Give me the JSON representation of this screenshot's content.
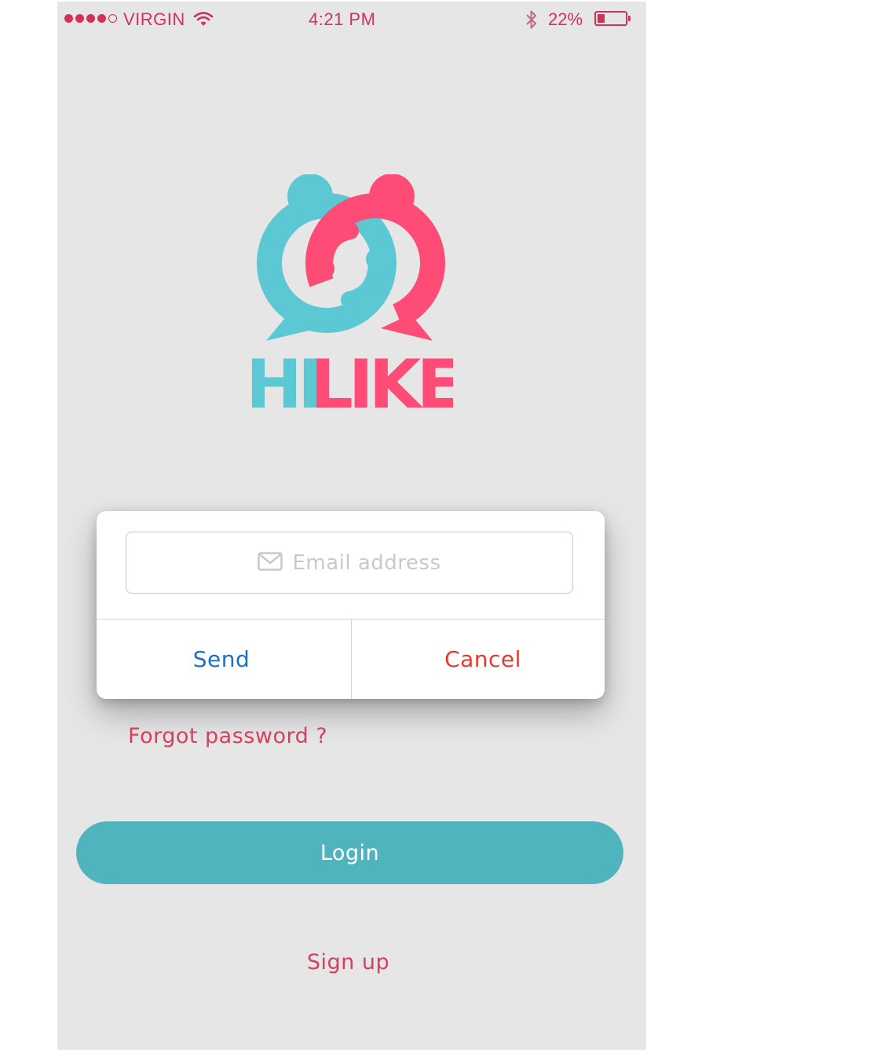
{
  "status_bar": {
    "carrier": "VIRGIN",
    "time": "4:21 PM",
    "battery_percent": "22%",
    "signal_bars": 4,
    "signal_total": 5,
    "battery_level": 0.22,
    "icons": [
      "signal-dots-icon",
      "wifi-icon",
      "bluetooth-icon",
      "battery-icon"
    ]
  },
  "logo": {
    "text_part1": "HI",
    "text_part2": "LIKE",
    "color_teal": "#5bc8d4",
    "color_pink": "#ff4c76"
  },
  "dialog": {
    "email_placeholder": "Email address",
    "email_icon": "envelope-icon",
    "send_label": "Send",
    "cancel_label": "Cancel"
  },
  "forgot_password_label": "Forgot password ?",
  "login_label": "Login",
  "signup_label": "Sign up",
  "colors": {
    "background": "#e6e6e6",
    "accent_pink": "#d6405e",
    "login_button": "#4fb4be",
    "send_blue": "#1f6fc4",
    "cancel_red": "#e13a2e"
  }
}
